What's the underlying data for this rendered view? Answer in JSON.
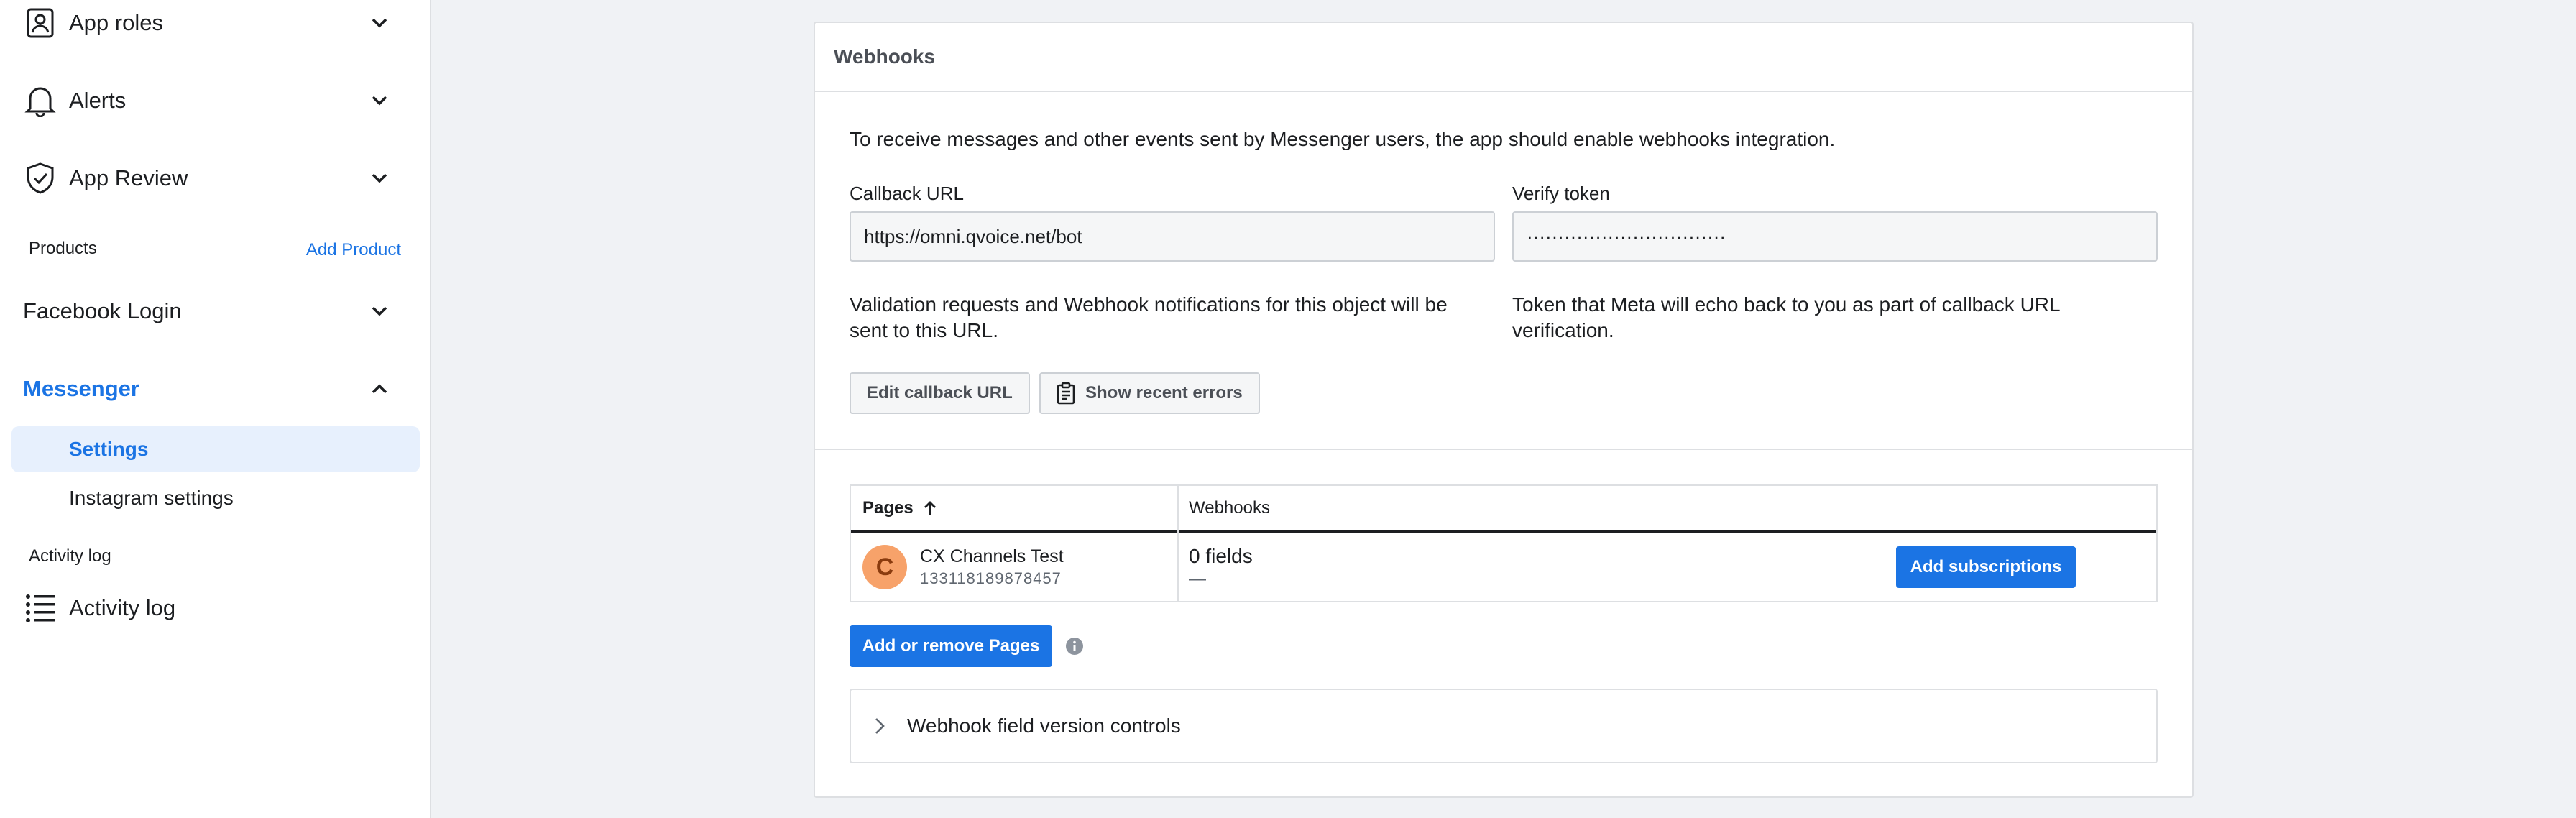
{
  "sidebar": {
    "app_roles": {
      "label": "App roles",
      "icon": "app-roles-icon"
    },
    "alerts": {
      "label": "Alerts",
      "icon": "bell-icon"
    },
    "app_review": {
      "label": "App Review",
      "icon": "shield-check-icon"
    },
    "products_heading": "Products",
    "add_product": "Add Product",
    "facebook_login": {
      "label": "Facebook Login"
    },
    "messenger": {
      "label": "Messenger",
      "expanded": true
    },
    "messenger_items": [
      {
        "label": "Settings",
        "selected": true
      },
      {
        "label": "Instagram settings",
        "selected": false
      }
    ],
    "activity_heading": "Activity log",
    "activity_log": {
      "label": "Activity log",
      "icon": "list-icon"
    }
  },
  "webhooks": {
    "title": "Webhooks",
    "intro": "To receive messages and other events sent by Messenger users, the app should enable webhooks integration.",
    "callback_label": "Callback URL",
    "callback_value": "https://omni.qvoice.net/bot",
    "verify_label": "Verify token",
    "verify_value": "································",
    "callback_help": "Validation requests and Webhook notifications for this object will be sent to this URL.",
    "verify_help": "Token that Meta will echo back to you as part of callback URL verification.",
    "edit_button": "Edit callback URL",
    "errors_button": "Show recent errors",
    "table": {
      "col_pages": "Pages",
      "col_webhooks": "Webhooks",
      "rows": [
        {
          "avatar_letter": "C",
          "name": "CX Channels Test",
          "id": "133118189878457",
          "fields": "0 fields",
          "fields_detail": "—",
          "action": "Add subscriptions"
        }
      ]
    },
    "add_remove_pages": "Add or remove Pages",
    "version_controls": "Webhook field version controls"
  },
  "colors": {
    "accent": "#1b74e4",
    "background": "#f0f2f5",
    "selected_bg": "#e7f0fd",
    "avatar": "#f7a26a"
  }
}
